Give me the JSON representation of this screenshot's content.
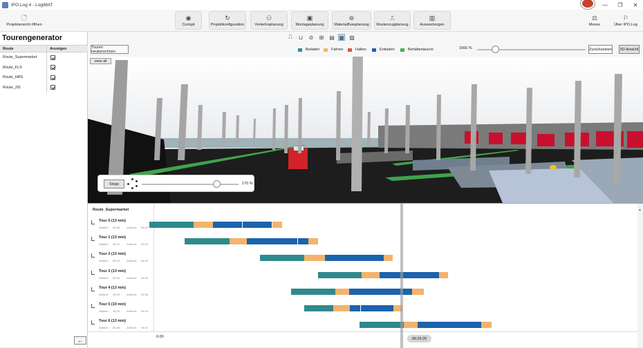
{
  "window": {
    "title": "IPO.Log 4 - LogiMAT",
    "minimize": "—",
    "maximize": "❐",
    "close": "✕"
  },
  "ribbon": {
    "open_project": "Projektansicht öffnen",
    "modules": [
      {
        "label": "Cockpit",
        "icon": "◉"
      },
      {
        "label": "Projektkonfiguration",
        "icon": "↻"
      },
      {
        "label": "Verkehrsplanung",
        "icon": "⚇"
      },
      {
        "label": "Montageplanung",
        "icon": "▣"
      },
      {
        "label": "Materialflussplanung",
        "icon": "⊚"
      },
      {
        "label": "Routenzugplanung",
        "icon": "⎍"
      },
      {
        "label": "Auswertungen",
        "icon": "▥"
      }
    ],
    "right": [
      {
        "label": "Messe",
        "icon": "⚖"
      },
      {
        "label": "Über IPO.Log",
        "icon": "⚐"
      }
    ]
  },
  "left_panel": {
    "title": "Tourengenerator",
    "columns": [
      "Route",
      "Anzeigen"
    ],
    "routes": [
      {
        "name": "Route_Supermarket",
        "show": true
      },
      {
        "name": "Route_FLS",
        "show": true
      },
      {
        "name": "Route_HRS",
        "show": true
      },
      {
        "name": "Route_JIS",
        "show": true
      }
    ],
    "collapse_icon": "←"
  },
  "toolbar": {
    "recalc_label": "Touren neuberechnen",
    "legend": [
      {
        "label": "Beladen",
        "color": "#2f8a8c"
      },
      {
        "label": "Fahren",
        "color": "#f4b36a"
      },
      {
        "label": "Halten",
        "color": "#d9534f"
      },
      {
        "label": "Entladen",
        "color": "#1c63ad"
      },
      {
        "label": "Behältertausch",
        "color": "#4caf50"
      }
    ],
    "zoom_label": "1666 %",
    "reset_label": "Zurücksetzen",
    "view3d_label": "3D-Ansicht"
  },
  "viewport": {
    "view_all_label": "view all",
    "stop_label": "Stopp",
    "speed_label": "170 %"
  },
  "gantt": {
    "route_title": "Route_Supermarket",
    "departure_prefix": "Abfahrt:",
    "arrival_prefix": "Ankunft:",
    "tours": [
      {
        "name": "Tour 0 (13 min)",
        "departure": "06:08",
        "arrival": "06:22"
      },
      {
        "name": "Tour 1 (13 min)",
        "departure": "06:12",
        "arrival": "06:25"
      },
      {
        "name": "Tour 2 (13 min)",
        "departure": "06:19",
        "arrival": "06:33"
      },
      {
        "name": "Tour 3 (13 min)",
        "departure": "06:25",
        "arrival": "06:39"
      },
      {
        "name": "Tour 4 (13 min)",
        "departure": "06:23",
        "arrival": "06:36"
      },
      {
        "name": "Tour 5 (10 min)",
        "departure": "06:24",
        "arrival": "06:34"
      },
      {
        "name": "Tour 6 (13 min)",
        "departure": "06:28",
        "arrival": "06:42"
      }
    ],
    "axis_start": "6:00",
    "current_time": "06:25:25"
  }
}
